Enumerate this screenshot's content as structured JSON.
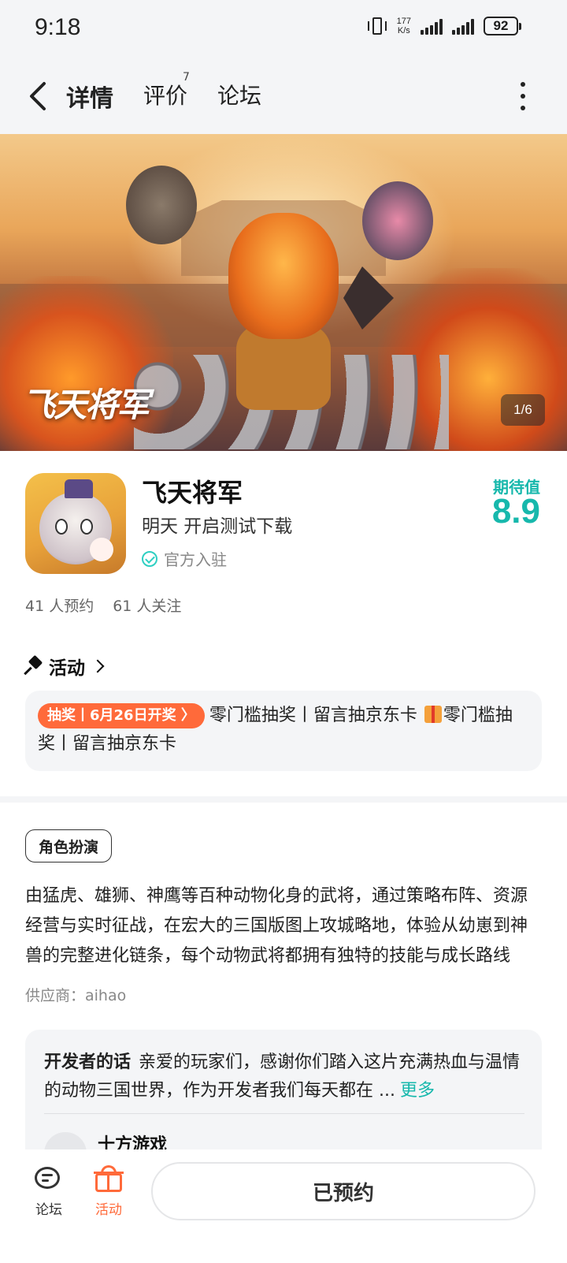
{
  "status_bar": {
    "time": "9:18",
    "net_speed_value": "177",
    "net_speed_unit": "K/s",
    "battery": "92"
  },
  "nav": {
    "tabs": [
      {
        "label": "详情",
        "active": true
      },
      {
        "label": "评价",
        "badge": "7"
      },
      {
        "label": "论坛"
      }
    ]
  },
  "banner": {
    "logo_text": "飞天将军",
    "counter": "1/6"
  },
  "app": {
    "name": "飞天将军",
    "status": "明天 开启测试下载",
    "official": "官方入驻",
    "expect_label": "期待值",
    "expect_value": "8.9",
    "reservations": "41 人预约",
    "followers": "61 人关注"
  },
  "activity": {
    "header": "活动",
    "tag": "抽奖丨6月26日开奖 〉",
    "text_before": "零门槛抽奖丨留言抽京东卡 ",
    "text_after": "零门槛抽奖丨留言抽京东卡"
  },
  "details": {
    "genre": "角色扮演",
    "description": "由猛虎、雄狮、神鹰等百种动物化身的武将，通过策略布阵、资源经营与实时征战，在宏大的三国版图上攻城略地，体验从幼崽到神兽的完整进化链条，每个动物武将都拥有独特的技能与成长路线",
    "supplier": "供应商：aihao"
  },
  "developer": {
    "label": "开发者的话",
    "text": "亲爱的玩家们，感谢你们踏入这片充满热血与温情的动物三国世界，作为开发者我们每天都在 ...",
    "more": "更多",
    "name": "十方游戏"
  },
  "bottom_bar": {
    "forum": "论坛",
    "activity": "活动",
    "reserved": "已预约"
  },
  "colors": {
    "accent": "#17b8ac",
    "tab_underline": "#2ecfc2",
    "activity_orange": "#ff6a3a",
    "card_bg": "#f4f5f7"
  }
}
